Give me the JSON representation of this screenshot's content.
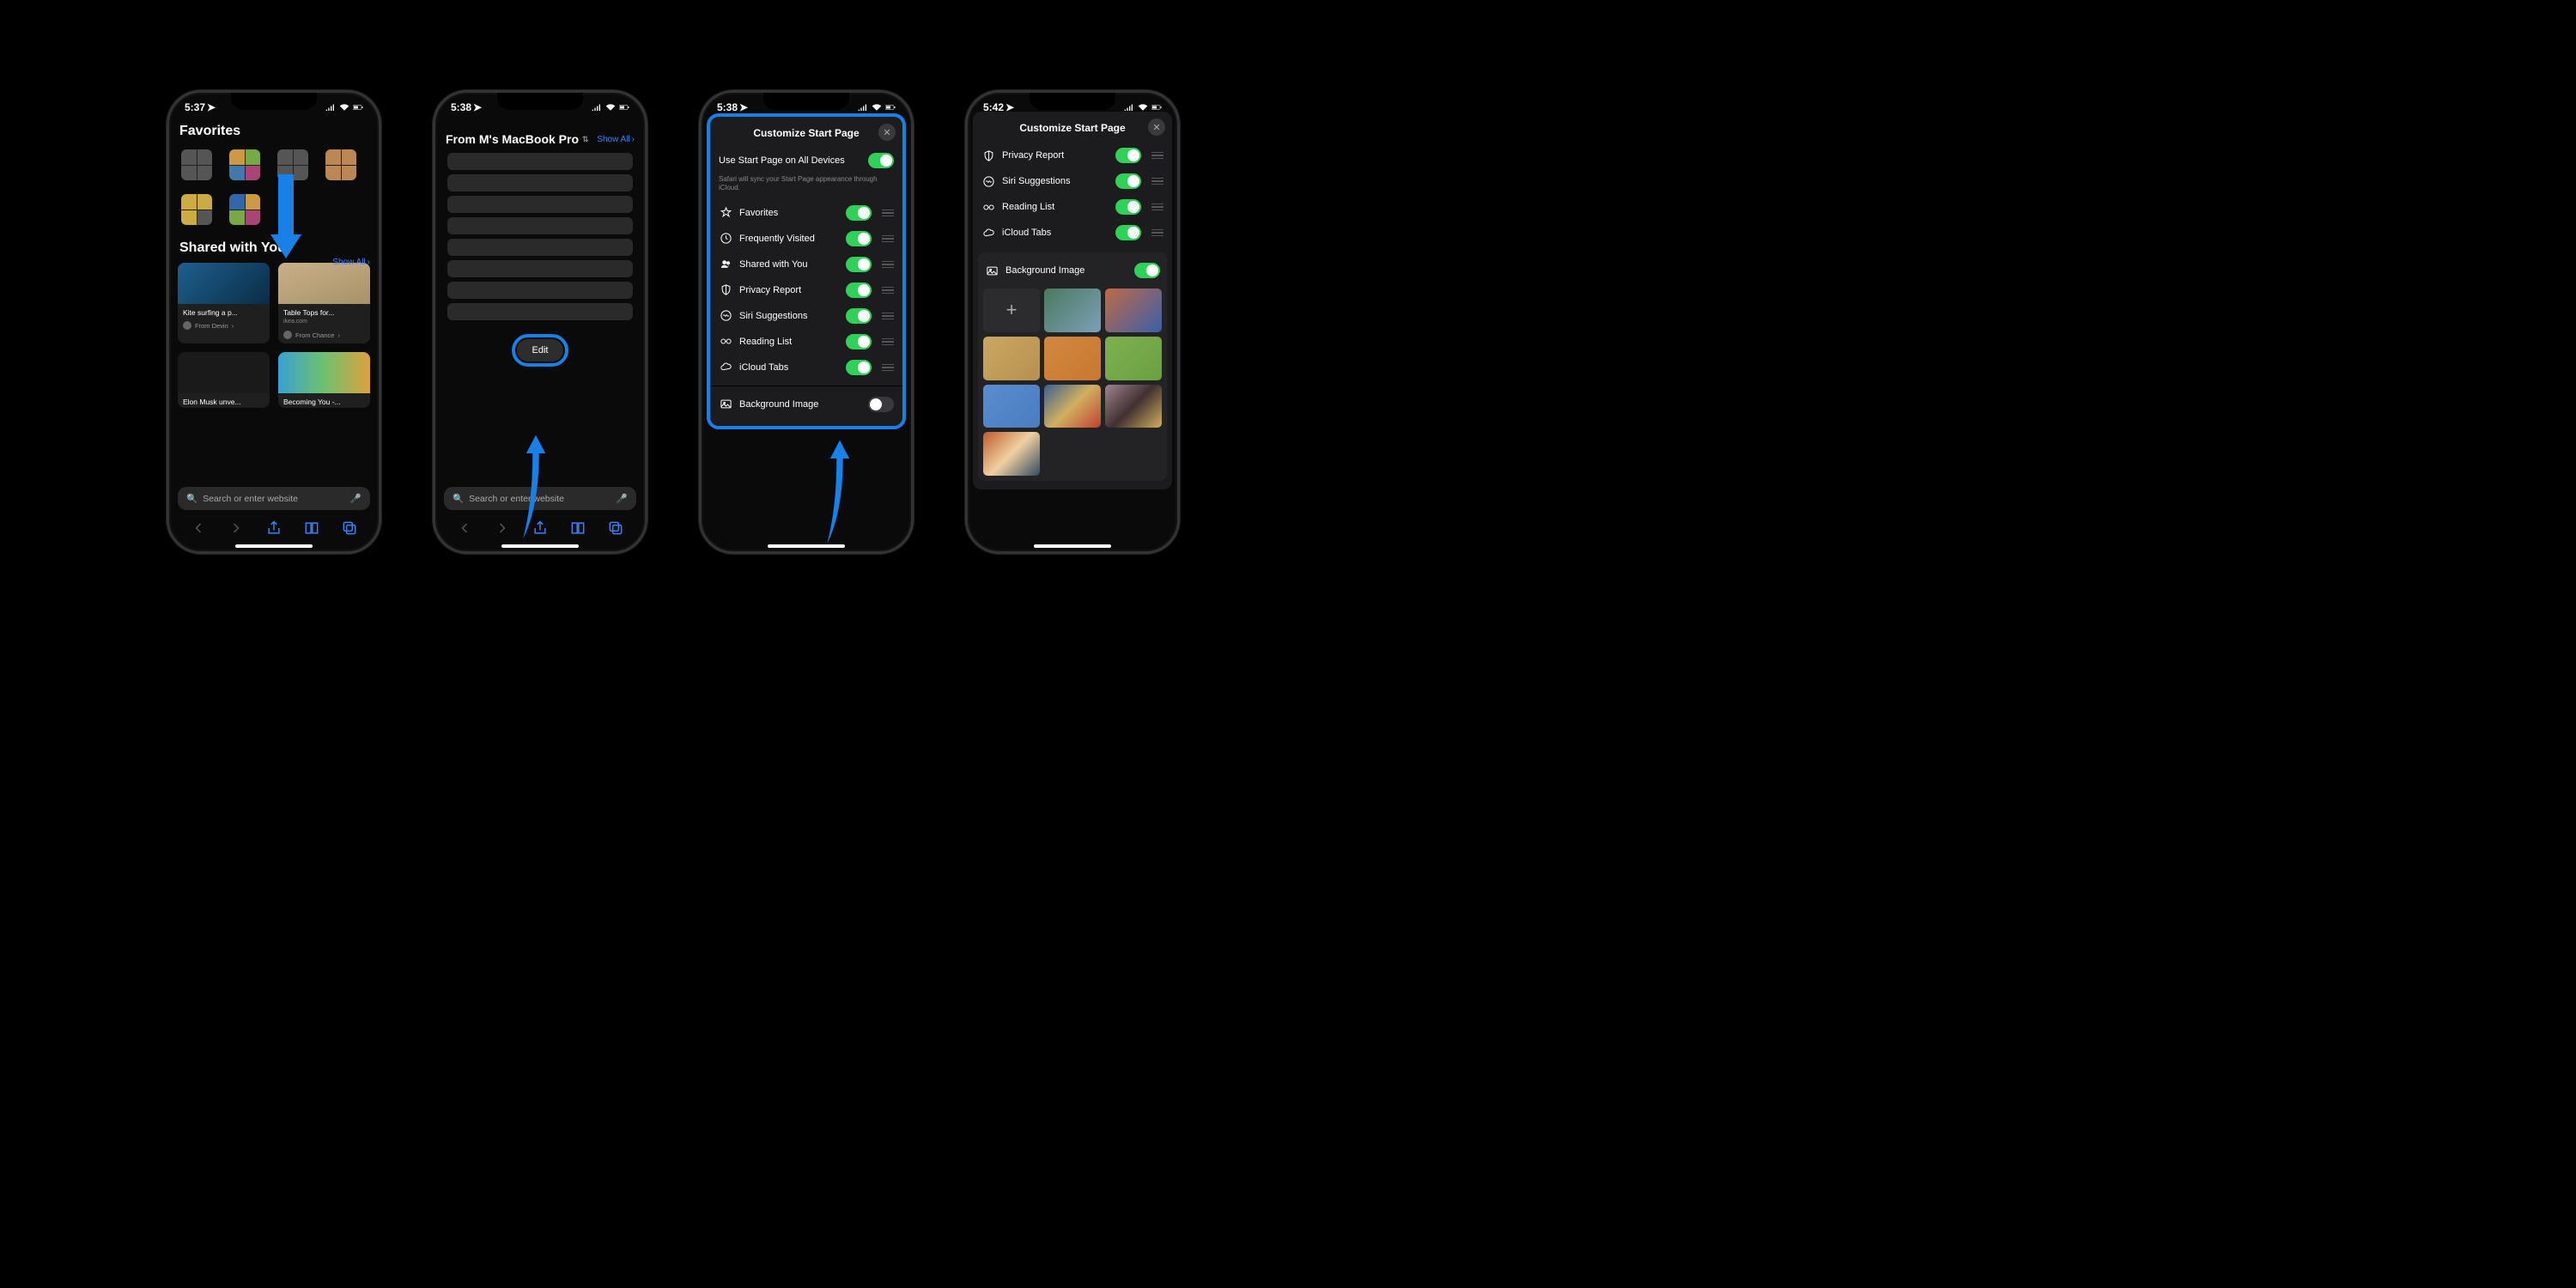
{
  "status": {
    "time1": "5:37",
    "time2": "5:38",
    "time3": "5:38",
    "time4": "5:42"
  },
  "screen1": {
    "favorites_title": "Favorites",
    "shared_title": "Shared with You",
    "show_all": "Show All",
    "cards": [
      {
        "title": "Kite surfing a p...",
        "from": "From Devin"
      },
      {
        "title": "Table Tops for...",
        "sub": "ikea.com",
        "from": "From Chance"
      },
      {
        "title": "Elon Musk unve...",
        "from": ""
      },
      {
        "title": "Becoming You -...",
        "from": ""
      }
    ],
    "search_placeholder": "Search or enter website"
  },
  "screen2": {
    "header": "From M's MacBook Pro",
    "show_all": "Show All",
    "edit_button": "Edit",
    "search_placeholder": "Search or enter website"
  },
  "screen3": {
    "title": "Customize Start Page",
    "sync_label": "Use Start Page on All Devices",
    "sync_desc": "Safari will sync your Start Page appearance through iCloud.",
    "options": [
      {
        "label": "Favorites",
        "icon": "star",
        "on": true
      },
      {
        "label": "Frequently Visited",
        "icon": "clock",
        "on": true
      },
      {
        "label": "Shared with You",
        "icon": "people",
        "on": true
      },
      {
        "label": "Privacy Report",
        "icon": "shield",
        "on": true
      },
      {
        "label": "Siri Suggestions",
        "icon": "siri",
        "on": true
      },
      {
        "label": "Reading List",
        "icon": "glasses",
        "on": true
      },
      {
        "label": "iCloud Tabs",
        "icon": "cloud",
        "on": true
      }
    ],
    "bg_label": "Background Image"
  },
  "screen4": {
    "title": "Customize Start Page",
    "options": [
      {
        "label": "Privacy Report",
        "icon": "shield",
        "on": true
      },
      {
        "label": "Siri Suggestions",
        "icon": "siri",
        "on": true
      },
      {
        "label": "Reading List",
        "icon": "glasses",
        "on": true
      },
      {
        "label": "iCloud Tabs",
        "icon": "cloud",
        "on": true
      }
    ],
    "bg_label": "Background Image",
    "bg_on": true,
    "bg_colors": [
      "add",
      "linear-gradient(135deg,#4a7a5e,#7da0b8)",
      "linear-gradient(135deg,#c06a45,#3a5fa8)",
      "linear-gradient(135deg,#c9a862,#b89050)",
      "linear-gradient(135deg,#d08840,#c97830)",
      "linear-gradient(135deg,#7fb050,#6aa040)",
      "linear-gradient(135deg,#5a8dd0,#4a7cc0)",
      "linear-gradient(135deg,#3a6090,#d0b060,#c04030)",
      "linear-gradient(135deg,#a08590,#403030,#d0b060)",
      "linear-gradient(135deg,#c05a30,#f0d0a0,#304a60)"
    ]
  }
}
